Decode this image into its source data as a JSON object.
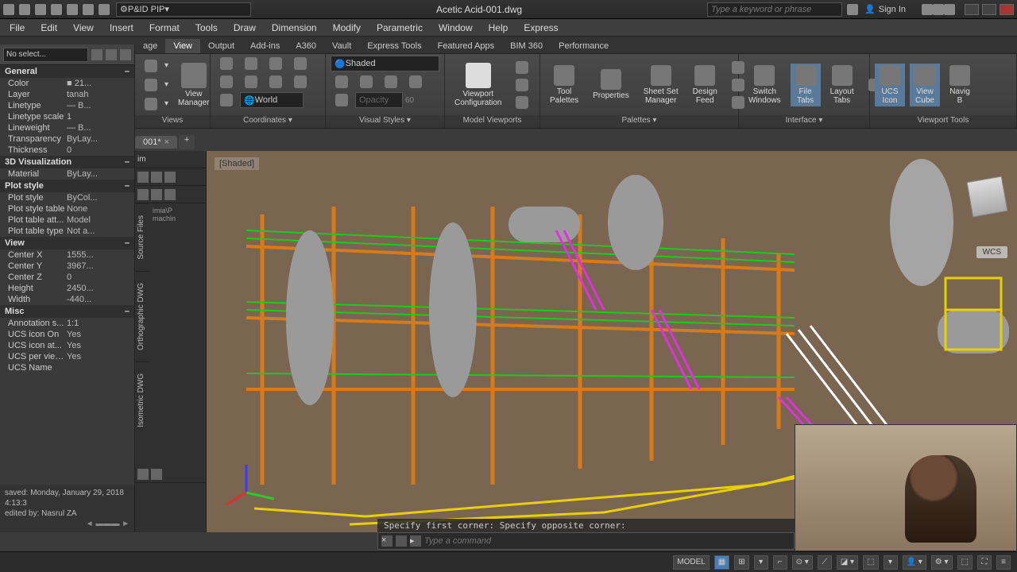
{
  "titlebar": {
    "style_dropdown": "P&ID PIP",
    "doc_title": "Acetic Acid-001.dwg",
    "search_placeholder": "Type a keyword or phrase",
    "signin": "Sign In"
  },
  "menus": [
    "File",
    "Edit",
    "View",
    "Insert",
    "Format",
    "Tools",
    "Draw",
    "Dimension",
    "Modify",
    "Parametric",
    "Window",
    "Help",
    "Express"
  ],
  "ribbon_tabs": [
    "age",
    "View",
    "Output",
    "Add-ins",
    "A360",
    "Vault",
    "Express Tools",
    "Featured Apps",
    "BIM 360",
    "Performance"
  ],
  "ribbon_active": "View",
  "ribbon_panels": {
    "views": {
      "title": "Views",
      "view_manager": "View\nManager"
    },
    "coordinates": {
      "title": "Coordinates",
      "world": "World"
    },
    "visual_styles": {
      "title": "Visual Styles",
      "shaded": "Shaded",
      "opacity_label": "Opacity",
      "opacity_val": "60"
    },
    "model_viewports": {
      "title": "Model Viewports",
      "vc": "Viewport\nConfiguration"
    },
    "palettes": {
      "title": "Palettes",
      "tp": "Tool\nPalettes",
      "prop": "Properties",
      "ssm": "Sheet Set\nManager",
      "df": "Design\nFeed"
    },
    "interface": {
      "title": "Interface",
      "sw": "Switch\nWindows",
      "ft": "File\nTabs",
      "lt": "Layout\nTabs"
    },
    "viewport_tools": {
      "title": "Viewport Tools",
      "ui": "UCS\nIcon",
      "vc": "View\nCube",
      "nav": "Navig\nB"
    }
  },
  "doctab": {
    "name": "001*"
  },
  "properties": {
    "selector": "No select...",
    "sections": {
      "general": {
        "title": "General",
        "rows": [
          {
            "l": "Color",
            "v": "■ 21..."
          },
          {
            "l": "Layer",
            "v": "tanah"
          },
          {
            "l": "Linetype",
            "v": "— B..."
          },
          {
            "l": "Linetype scale",
            "v": "1"
          },
          {
            "l": "Lineweight",
            "v": "— B..."
          },
          {
            "l": "Transparency",
            "v": "ByLay..."
          },
          {
            "l": "Thickness",
            "v": "0"
          }
        ]
      },
      "viz3d": {
        "title": "3D Visualization",
        "rows": [
          {
            "l": "Material",
            "v": "ByLay..."
          }
        ]
      },
      "plot": {
        "title": "Plot style",
        "rows": [
          {
            "l": "Plot style",
            "v": "ByCol..."
          },
          {
            "l": "Plot style table",
            "v": "None"
          },
          {
            "l": "Plot table att...",
            "v": "Model"
          },
          {
            "l": "Plot table type",
            "v": "Not a..."
          }
        ]
      },
      "view": {
        "title": "View",
        "rows": [
          {
            "l": "Center X",
            "v": "1555..."
          },
          {
            "l": "Center Y",
            "v": "3967..."
          },
          {
            "l": "Center Z",
            "v": "0"
          },
          {
            "l": "Height",
            "v": "2450..."
          },
          {
            "l": "Width",
            "v": "-440..."
          }
        ]
      },
      "misc": {
        "title": "Misc",
        "rows": [
          {
            "l": "Annotation s...",
            "v": "1:1"
          },
          {
            "l": "UCS icon On",
            "v": "Yes"
          },
          {
            "l": "UCS icon at...",
            "v": "Yes"
          },
          {
            "l": "UCS per view...",
            "v": "Yes"
          },
          {
            "l": "UCS Name",
            "v": ""
          }
        ]
      }
    },
    "footer_saved": "saved: Monday, January 29, 2018 4:13:3",
    "footer_edited": "edited by: Nasrul ZA"
  },
  "leftstrip": {
    "tabs": [
      "Source Files",
      "Orthographic DWG",
      "Isometric DWG"
    ],
    "item1": "im",
    "item2": "imia\\P\nmachin"
  },
  "viewport": {
    "label": "[Shaded]",
    "wcs": "WCS"
  },
  "command": {
    "history": "Specify first corner: Specify opposite corner:",
    "placeholder": "Type a command"
  },
  "statusbar": {
    "model": "MODEL"
  }
}
